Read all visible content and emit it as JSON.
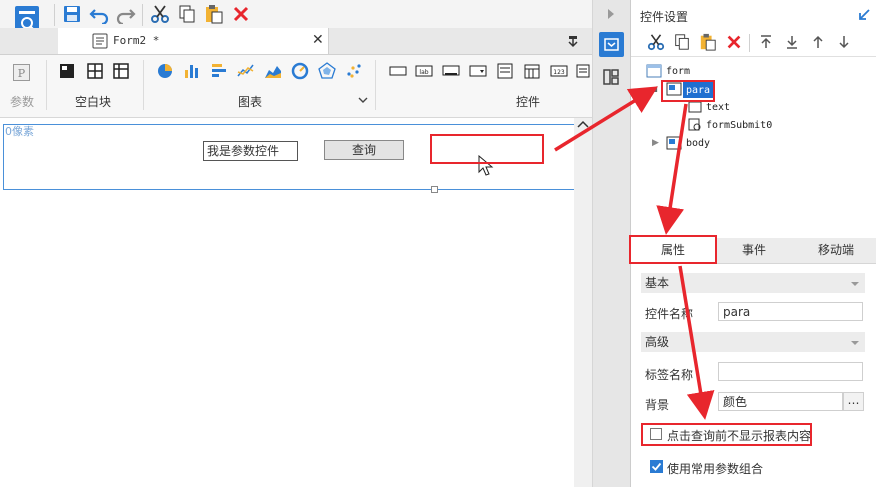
{
  "tabs": {
    "form2": "Form2 *"
  },
  "ribbon": {
    "groups": {
      "param": "参数",
      "blank": "空白块",
      "chart": "图表",
      "control": "控件"
    },
    "param_icon": "P"
  },
  "canvas": {
    "pixel_label": "0像素",
    "param_textbox": "我是参数控件",
    "query_button": "查询"
  },
  "right_panel": {
    "title": "控件设置",
    "tree": {
      "form": "form",
      "para": "para",
      "text": "text",
      "submit": "formSubmit0",
      "body": "body"
    },
    "tabs": {
      "properties": "属性",
      "events": "事件",
      "mobile": "移动端"
    },
    "sections": {
      "basic": "基本",
      "advanced": "高级"
    },
    "fields": {
      "widget_name_label": "控件名称",
      "widget_name_value": "para",
      "label_name_label": "标签名称",
      "background_label": "背景",
      "background_value": "颜色"
    },
    "checkboxes": {
      "hide_before_query": "点击查询前不显示报表内容",
      "use_common_params": "使用常用参数组合"
    }
  },
  "colors": {
    "accent": "#2a7bd3",
    "annotation": "#e8262d",
    "selection": "#1e6fd0"
  }
}
